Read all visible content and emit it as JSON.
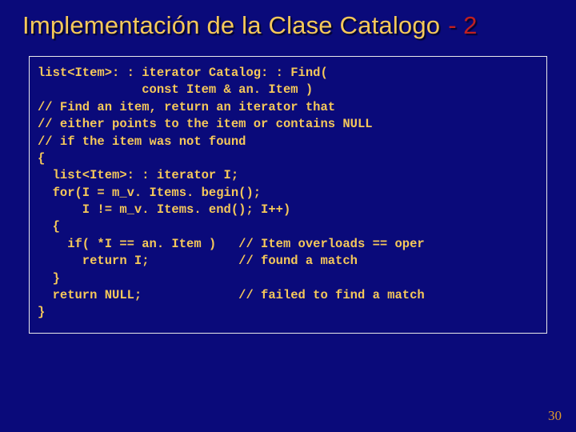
{
  "title": {
    "main": "Implementación de la Clase Catalogo",
    "suffix": "- 2"
  },
  "code": "list<Item>: : iterator Catalog: : Find(\n              const Item & an. Item )\n// Find an item, return an iterator that\n// either points to the item or contains NULL\n// if the item was not found\n{\n  list<Item>: : iterator I;\n  for(I = m_v. Items. begin();\n      I != m_v. Items. end(); I++)\n  {\n    if( *I == an. Item )   // Item overloads == oper\n      return I;            // found a match\n  }\n  return NULL;             // failed to find a match\n}",
  "page_number": "30"
}
